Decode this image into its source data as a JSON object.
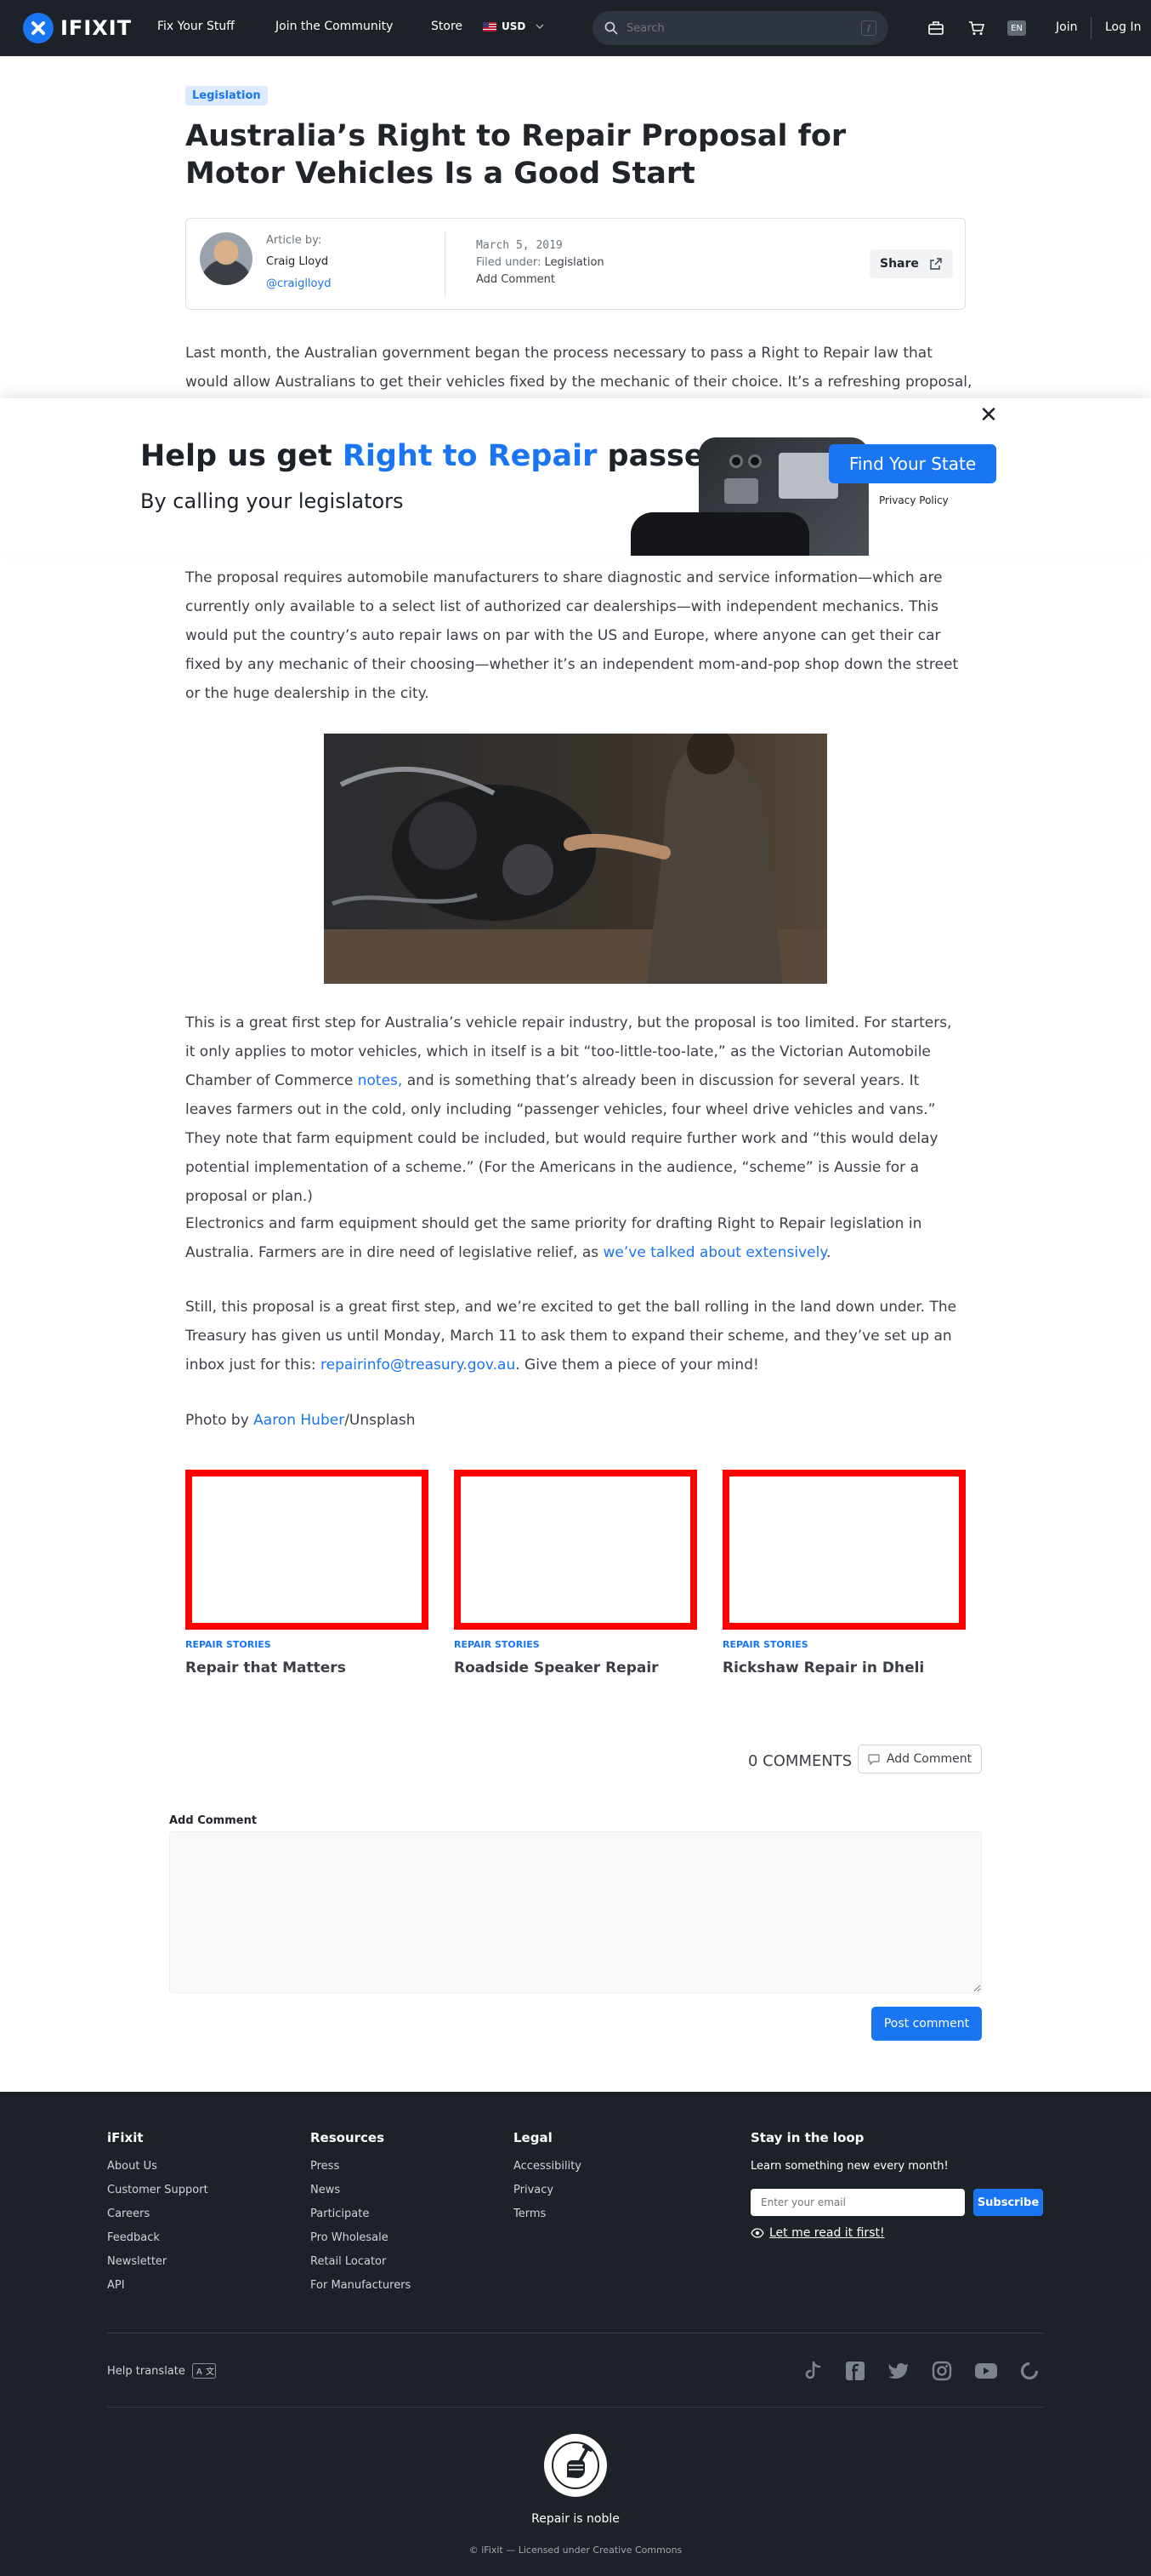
{
  "nav": {
    "logo": "IFIXIT",
    "links": [
      "Fix Your Stuff",
      "Join the Community",
      "Store"
    ],
    "currency": "USD",
    "search_placeholder": "Search",
    "search_shortcut": "/",
    "language": "EN",
    "join": "Join",
    "login": "Log In"
  },
  "article": {
    "category": "Legislation",
    "title": "Australia’s Right to Repair Proposal for Motor Vehicles Is a Good Start",
    "author_label": "Article by:",
    "author_name": "Craig Lloyd",
    "author_handle": "@craiglloyd",
    "date": "March 5, 2019",
    "filed_under_label": "Filed under:",
    "filed_under": "Legislation",
    "add_comment": "Add Comment",
    "share": "Share",
    "intro_line1": "Last month, the Australian government began the process necessary to pass a Right to Repair law that",
    "intro_line2": "would allow Australians to get their vehicles fixed by the mechanic of their choice. It’s a refreshing proposal,",
    "p1": "The proposal requires automobile manufacturers to share diagnostic and service information—which are currently only available to a select list of authorized car dealerships—with independent mechanics. This would put the country’s auto repair laws on par with the US and Europe, where anyone can get their car fixed by any mechanic of their choosing—whether it’s an independent mom-and-pop shop down the street or the huge dealership in the city.",
    "p2_a": "This is a great first step for Australia’s vehicle repair industry, but the proposal is too limited. For starters, it only applies to motor vehicles, which in itself is a bit “too-little-too-late,” as the Victorian Automobile Chamber of Commerce ",
    "p2_link": "notes,",
    "p2_b": " and is something that’s already been in discussion for several years. It leaves farmers out in the cold, only including “passenger vehicles, four wheel drive vehicles and vans.” They note that farm equipment could be included, but would require further work and “this would delay potential implementation of a scheme.” (For the Americans in the audience, “scheme” is Aussie for a proposal or plan.)",
    "p3_a": "Electronics and farm equipment should get the same priority for drafting Right to Repair legislation in Australia. Farmers are in dire need of legislative relief, as ",
    "p3_link": "we’ve talked about extensively",
    "p3_b": ".",
    "p4_a": "Still, this proposal is a great first step, and we’re excited to get the ball rolling in the land down under. The Treasury has given us until Monday, March 11 to ask them to expand their scheme, and they’ve set up an inbox just for this: ",
    "p4_link": "repairinfo@treasury.gov.au",
    "p4_b": ". Give them a piece of your mind!",
    "photo_a": "Photo by ",
    "photo_link": "Aaron Huber",
    "photo_b": "/Unsplash"
  },
  "banner": {
    "title_a": "Help us get ",
    "title_hl": "Right to Repair",
    "title_b": " passed",
    "subtitle": "By calling your legislators",
    "cta": "Find Your State",
    "privacy": "Privacy Policy"
  },
  "related": [
    {
      "tag": "REPAIR STORIES",
      "title": "Repair that Matters"
    },
    {
      "tag": "REPAIR STORIES",
      "title": "Roadside Speaker Repair"
    },
    {
      "tag": "REPAIR STORIES",
      "title": "Rickshaw Repair in Dheli"
    }
  ],
  "comments": {
    "count": "0 COMMENTS",
    "add_button": "Add Comment",
    "label": "Add Comment",
    "post": "Post comment"
  },
  "footer": {
    "col1": {
      "head": "iFixit",
      "links": [
        "About Us",
        "Customer Support",
        "Careers",
        "Feedback",
        "Newsletter",
        "API"
      ]
    },
    "col2": {
      "head": "Resources",
      "links": [
        "Press",
        "News",
        "Participate",
        "Pro Wholesale",
        "Retail Locator",
        "For Manufacturers"
      ]
    },
    "col3": {
      "head": "Legal",
      "links": [
        "Accessibility",
        "Privacy",
        "Terms"
      ]
    },
    "newsletter": {
      "head": "Stay in the loop",
      "sub": "Learn something new every month!",
      "placeholder": "Enter your email",
      "subscribe": "Subscribe",
      "read_link": "Let me read it first!"
    },
    "help_translate": "Help translate",
    "motto": "Repair is noble",
    "copyright": "© iFixit — Licensed under Creative Commons"
  },
  "colors": {
    "accent": "#1975f1",
    "nav_bg": "#1d2128",
    "card_border": "#ff0000"
  }
}
